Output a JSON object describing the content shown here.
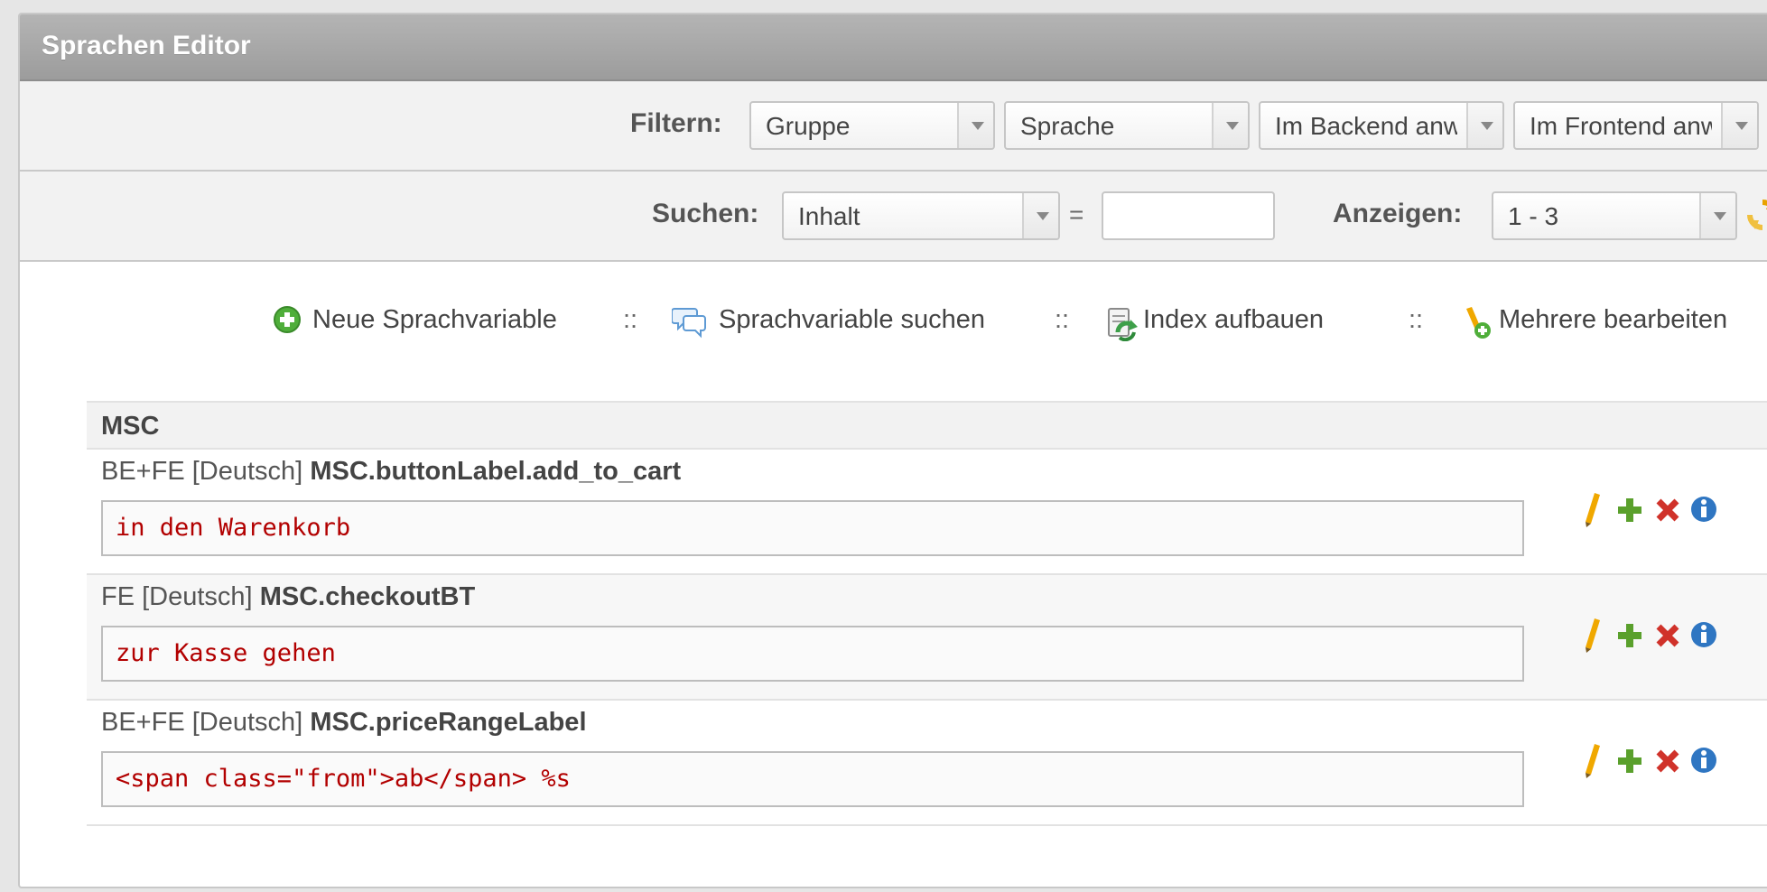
{
  "title": "Sprachen Editor",
  "filter": {
    "label": "Filtern:",
    "group": "Gruppe",
    "language": "Sprache",
    "backend": "Im Backend anw",
    "frontend": "Im Frontend anw"
  },
  "search": {
    "label": "Suchen:",
    "field": "Inhalt",
    "equals": "=",
    "value": "",
    "show_label": "Anzeigen:",
    "range": "1 - 3"
  },
  "actions": [
    {
      "label": "Neue Sprachvariable",
      "icon": "add-circle-icon"
    },
    {
      "label": "Sprachvariable suchen",
      "icon": "speech-bubbles-icon"
    },
    {
      "label": "Index aufbauen",
      "icon": "rebuild-index-icon"
    },
    {
      "label": "Mehrere bearbeiten",
      "icon": "edit-multiple-icon"
    }
  ],
  "separator": "::",
  "group": {
    "name": "MSC",
    "entries": [
      {
        "scope": "BE+FE [Deutsch]",
        "key": "MSC.buttonLabel.add_to_cart",
        "value": "in den Warenkorb"
      },
      {
        "scope": "FE [Deutsch]",
        "key": "MSC.checkoutBT",
        "value": "zur Kasse gehen"
      },
      {
        "scope": "BE+FE [Deutsch]",
        "key": "MSC.priceRangeLabel",
        "value": "<span class=\"from\">ab</span> %s"
      }
    ]
  },
  "colors": {
    "edit": "#f0a800",
    "copy": "#5aa02c",
    "delete": "#d0322a",
    "info": "#2f76c2",
    "value_text": "#b20000"
  }
}
